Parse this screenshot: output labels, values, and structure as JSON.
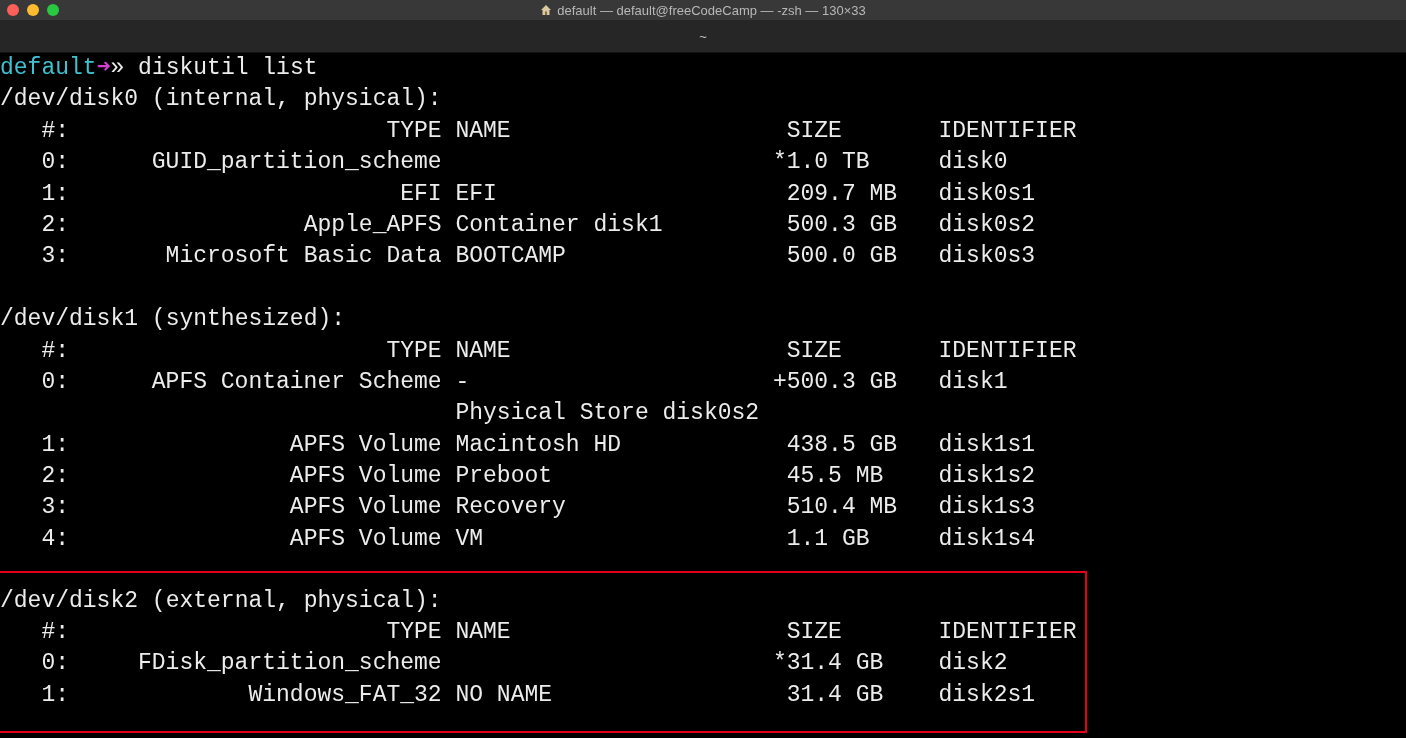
{
  "window": {
    "title": "default — default@freeCodeCamp — -zsh — 130×33",
    "tab": "~"
  },
  "prompt": {
    "user": "default",
    "arrow": "➜",
    "mark": "»",
    "command": "diskutil list"
  },
  "sections": [
    {
      "title": "/dev/disk0 (internal, physical):",
      "highlighted": false,
      "header": {
        "index": "#:",
        "type": "TYPE",
        "name": "NAME",
        "size": "SIZE",
        "identifier": "IDENTIFIER"
      },
      "rows": [
        {
          "index": "0:",
          "type": "GUID_partition_scheme",
          "name": "",
          "size_prefix": "*",
          "size": "1.0 TB",
          "identifier": "disk0"
        },
        {
          "index": "1:",
          "type": "EFI",
          "name": "EFI",
          "size": "209.7 MB",
          "identifier": "disk0s1"
        },
        {
          "index": "2:",
          "type": "Apple_APFS",
          "name": "Container disk1",
          "size": "500.3 GB",
          "identifier": "disk0s2"
        },
        {
          "index": "3:",
          "type": "Microsoft Basic Data",
          "name": "BOOTCAMP",
          "size": "500.0 GB",
          "identifier": "disk0s3"
        }
      ]
    },
    {
      "title": "/dev/disk1 (synthesized):",
      "highlighted": false,
      "header": {
        "index": "#:",
        "type": "TYPE",
        "name": "NAME",
        "size": "SIZE",
        "identifier": "IDENTIFIER"
      },
      "rows": [
        {
          "index": "0:",
          "type": "APFS Container Scheme",
          "name": "-",
          "size_prefix": "+",
          "size": "500.3 GB",
          "identifier": "disk1"
        },
        {
          "name": "Physical Store disk0s2"
        },
        {
          "index": "1:",
          "type": "APFS Volume",
          "name": "Macintosh HD",
          "size": "438.5 GB",
          "identifier": "disk1s1"
        },
        {
          "index": "2:",
          "type": "APFS Volume",
          "name": "Preboot",
          "size": "45.5 MB",
          "identifier": "disk1s2"
        },
        {
          "index": "3:",
          "type": "APFS Volume",
          "name": "Recovery",
          "size": "510.4 MB",
          "identifier": "disk1s3"
        },
        {
          "index": "4:",
          "type": "APFS Volume",
          "name": "VM",
          "size": "1.1 GB",
          "identifier": "disk1s4"
        }
      ]
    },
    {
      "title": "/dev/disk2 (external, physical):",
      "highlighted": true,
      "header": {
        "index": "#:",
        "type": "TYPE",
        "name": "NAME",
        "size": "SIZE",
        "identifier": "IDENTIFIER"
      },
      "rows": [
        {
          "index": "0:",
          "type": "FDisk_partition_scheme",
          "name": "",
          "size_prefix": "*",
          "size": "31.4 GB",
          "identifier": "disk2"
        },
        {
          "index": "1:",
          "type": "Windows_FAT_32",
          "name": "NO NAME",
          "size": "31.4 GB",
          "identifier": "disk2s1"
        }
      ]
    }
  ]
}
